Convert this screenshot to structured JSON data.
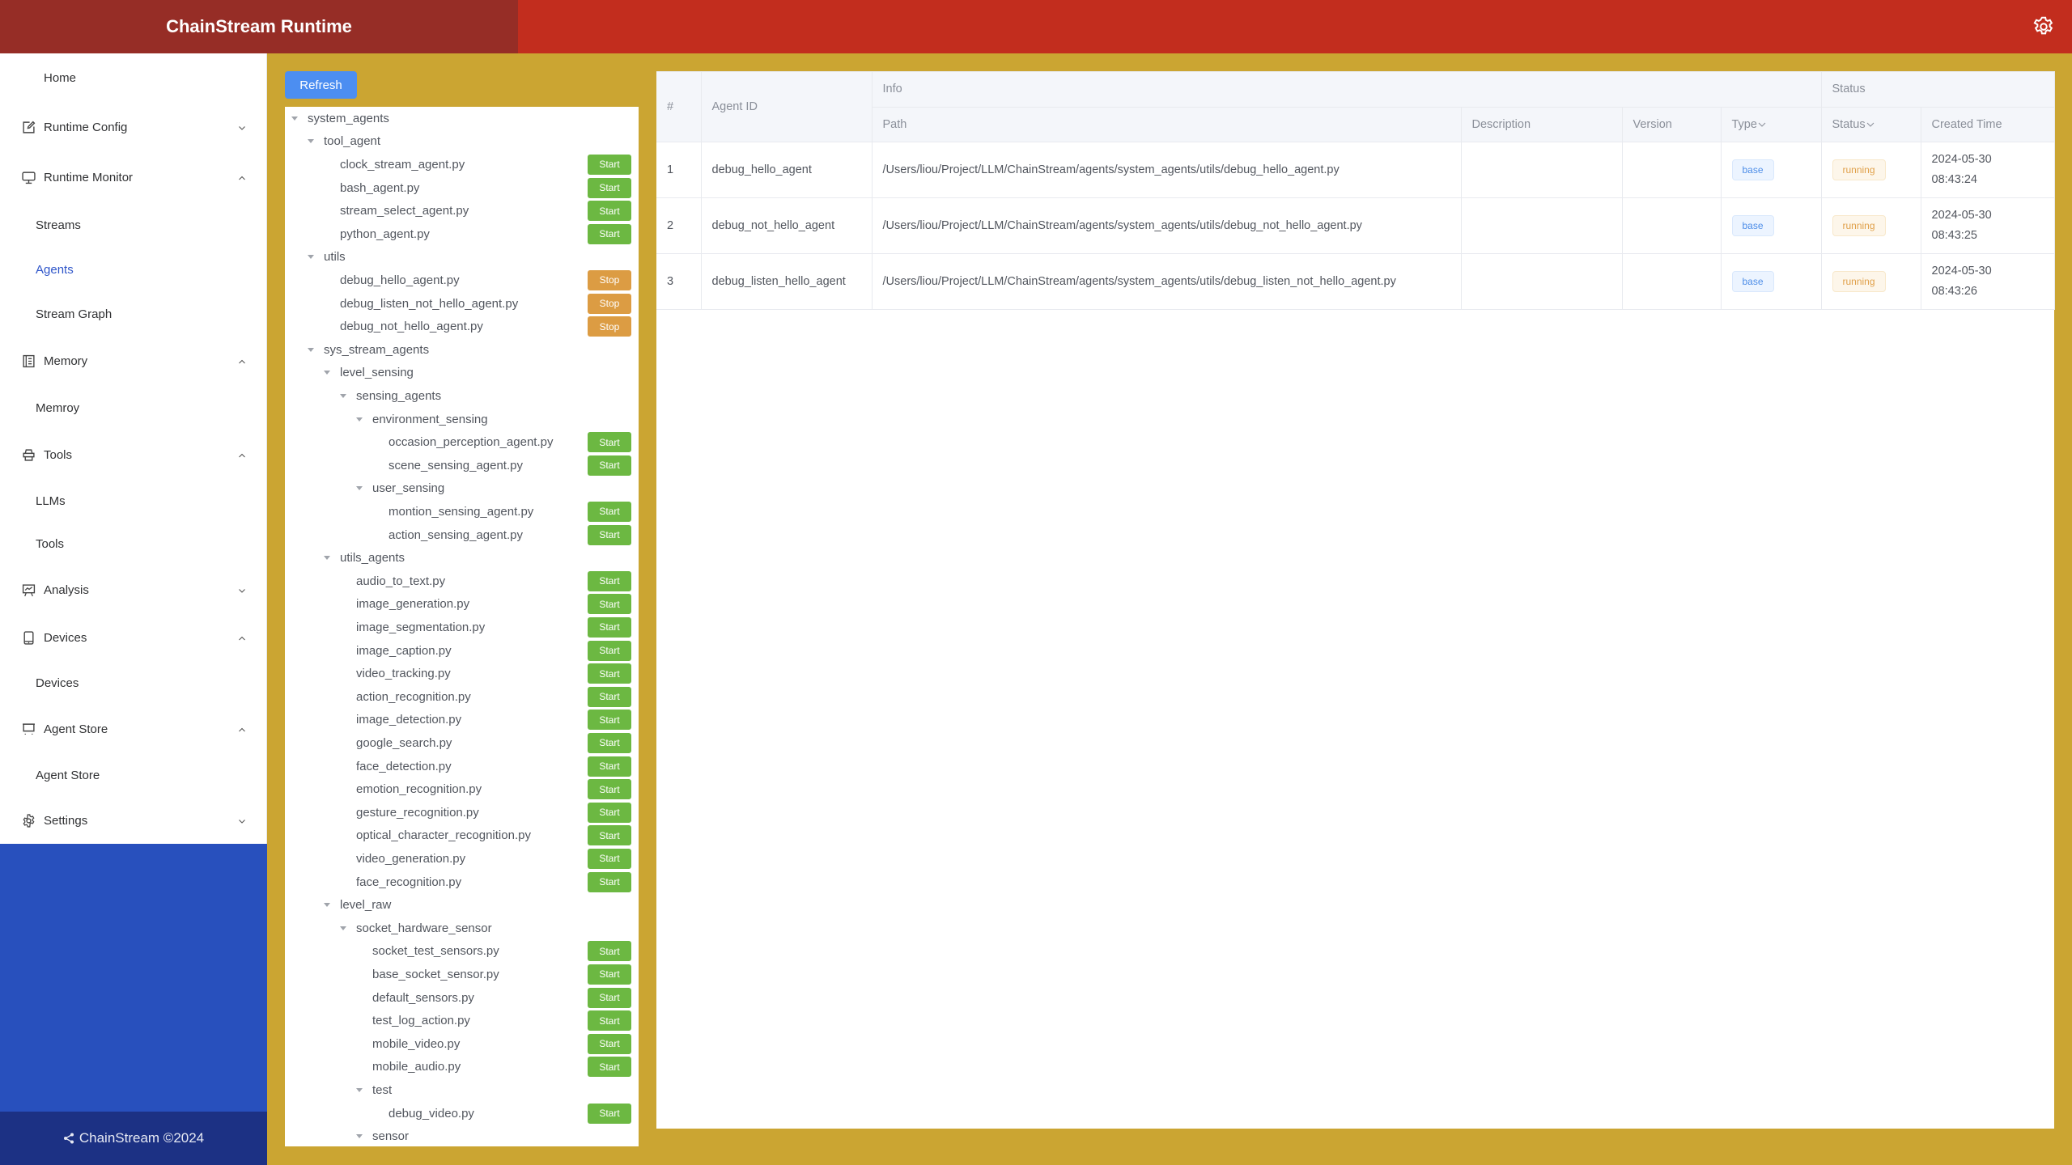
{
  "header": {
    "title": "ChainStream Runtime",
    "settings_icon": "gear-icon"
  },
  "sidebar": {
    "items": [
      {
        "label": "Home",
        "type": "item",
        "icon": null
      },
      {
        "label": "Runtime Config",
        "type": "group",
        "icon": "edit-icon",
        "expanded": false
      },
      {
        "label": "Runtime Monitor",
        "type": "group",
        "icon": "monitor-icon",
        "expanded": true
      },
      {
        "label": "Streams",
        "type": "sub"
      },
      {
        "label": "Agents",
        "type": "sub",
        "active": true
      },
      {
        "label": "Stream Graph",
        "type": "sub"
      },
      {
        "label": "Memory",
        "type": "group",
        "icon": "memory-icon",
        "expanded": true
      },
      {
        "label": "Memroy",
        "type": "sub"
      },
      {
        "label": "Tools",
        "type": "group",
        "icon": "tools-icon",
        "expanded": true
      },
      {
        "label": "LLMs",
        "type": "sub"
      },
      {
        "label": "Tools",
        "type": "sub"
      },
      {
        "label": "Analysis",
        "type": "group",
        "icon": "analysis-icon",
        "expanded": false
      },
      {
        "label": "Devices",
        "type": "group",
        "icon": "device-icon",
        "expanded": true
      },
      {
        "label": "Devices",
        "type": "sub"
      },
      {
        "label": "Agent Store",
        "type": "group",
        "icon": "store-icon",
        "expanded": true
      },
      {
        "label": "Agent Store",
        "type": "sub"
      },
      {
        "label": "Settings",
        "type": "group",
        "icon": "settings-icon",
        "expanded": false
      }
    ],
    "footer": "ChainStream ©2024"
  },
  "toolbar": {
    "refresh_label": "Refresh"
  },
  "tree": [
    {
      "name": "system_agents",
      "level": 0,
      "folder": true
    },
    {
      "name": "tool_agent",
      "level": 1,
      "folder": true
    },
    {
      "name": "clock_stream_agent.py",
      "level": 2,
      "action": "Start"
    },
    {
      "name": "bash_agent.py",
      "level": 2,
      "action": "Start"
    },
    {
      "name": "stream_select_agent.py",
      "level": 2,
      "action": "Start"
    },
    {
      "name": "python_agent.py",
      "level": 2,
      "action": "Start"
    },
    {
      "name": "utils",
      "level": 1,
      "folder": true
    },
    {
      "name": "debug_hello_agent.py",
      "level": 2,
      "action": "Stop"
    },
    {
      "name": "debug_listen_not_hello_agent.py",
      "level": 2,
      "action": "Stop"
    },
    {
      "name": "debug_not_hello_agent.py",
      "level": 2,
      "action": "Stop"
    },
    {
      "name": "sys_stream_agents",
      "level": 1,
      "folder": true
    },
    {
      "name": "level_sensing",
      "level": 2,
      "folder": true
    },
    {
      "name": "sensing_agents",
      "level": 3,
      "folder": true
    },
    {
      "name": "environment_sensing",
      "level": 4,
      "folder": true
    },
    {
      "name": "occasion_perception_agent.py",
      "level": 5,
      "action": "Start"
    },
    {
      "name": "scene_sensing_agent.py",
      "level": 5,
      "action": "Start"
    },
    {
      "name": "user_sensing",
      "level": 4,
      "folder": true
    },
    {
      "name": "montion_sensing_agent.py",
      "level": 5,
      "action": "Start"
    },
    {
      "name": "action_sensing_agent.py",
      "level": 5,
      "action": "Start"
    },
    {
      "name": "utils_agents",
      "level": 2,
      "folder": true
    },
    {
      "name": "audio_to_text.py",
      "level": 3,
      "action": "Start"
    },
    {
      "name": "image_generation.py",
      "level": 3,
      "action": "Start"
    },
    {
      "name": "image_segmentation.py",
      "level": 3,
      "action": "Start"
    },
    {
      "name": "image_caption.py",
      "level": 3,
      "action": "Start"
    },
    {
      "name": "video_tracking.py",
      "level": 3,
      "action": "Start"
    },
    {
      "name": "action_recognition.py",
      "level": 3,
      "action": "Start"
    },
    {
      "name": "image_detection.py",
      "level": 3,
      "action": "Start"
    },
    {
      "name": "google_search.py",
      "level": 3,
      "action": "Start"
    },
    {
      "name": "face_detection.py",
      "level": 3,
      "action": "Start"
    },
    {
      "name": "emotion_recognition.py",
      "level": 3,
      "action": "Start"
    },
    {
      "name": "gesture_recognition.py",
      "level": 3,
      "action": "Start"
    },
    {
      "name": "optical_character_recognition.py",
      "level": 3,
      "action": "Start"
    },
    {
      "name": "video_generation.py",
      "level": 3,
      "action": "Start"
    },
    {
      "name": "face_recognition.py",
      "level": 3,
      "action": "Start"
    },
    {
      "name": "level_raw",
      "level": 2,
      "folder": true
    },
    {
      "name": "socket_hardware_sensor",
      "level": 3,
      "folder": true
    },
    {
      "name": "socket_test_sensors.py",
      "level": 4,
      "action": "Start"
    },
    {
      "name": "base_socket_sensor.py",
      "level": 4,
      "action": "Start"
    },
    {
      "name": "default_sensors.py",
      "level": 4,
      "action": "Start"
    },
    {
      "name": "test_log_action.py",
      "level": 4,
      "action": "Start"
    },
    {
      "name": "mobile_video.py",
      "level": 4,
      "action": "Start"
    },
    {
      "name": "mobile_audio.py",
      "level": 4,
      "action": "Start"
    },
    {
      "name": "test",
      "level": 4,
      "folder": true
    },
    {
      "name": "debug_video.py",
      "level": 5,
      "action": "Start"
    },
    {
      "name": "sensor",
      "level": 4,
      "folder": true
    }
  ],
  "table": {
    "group_headers": {
      "info": "Info",
      "status": "Status"
    },
    "headers": {
      "index": "#",
      "agent_id": "Agent ID",
      "path": "Path",
      "description": "Description",
      "version": "Version",
      "type": "Type",
      "status": "Status",
      "created_time": "Created Time"
    },
    "rows": [
      {
        "index": "1",
        "agent_id": "debug_hello_agent",
        "path": "/Users/liou/Project/LLM/ChainStream/agents/system_agents/utils/debug_hello_agent.py",
        "description": "",
        "version": "",
        "type": "base",
        "status": "running",
        "created_date": "2024-05-30",
        "created_clock": "08:43:24"
      },
      {
        "index": "2",
        "agent_id": "debug_not_hello_agent",
        "path": "/Users/liou/Project/LLM/ChainStream/agents/system_agents/utils/debug_not_hello_agent.py",
        "description": "",
        "version": "",
        "type": "base",
        "status": "running",
        "created_date": "2024-05-30",
        "created_clock": "08:43:25"
      },
      {
        "index": "3",
        "agent_id": "debug_listen_hello_agent",
        "path": "/Users/liou/Project/LLM/ChainStream/agents/system_agents/utils/debug_listen_not_hello_agent.py",
        "description": "",
        "version": "",
        "type": "base",
        "status": "running",
        "created_date": "2024-05-30",
        "created_clock": "08:43:26"
      }
    ]
  },
  "colors": {
    "header_bg": "#c22d1e",
    "brand_bg": "#962d26",
    "content_bg": "#cba532",
    "sidebar_fill": "#2850bd",
    "footer_bg": "#1c3184",
    "active_link": "#2e55c9",
    "start_button": "#6cb842",
    "stop_button": "#dc9c43",
    "refresh_button": "#4c8ef1"
  }
}
